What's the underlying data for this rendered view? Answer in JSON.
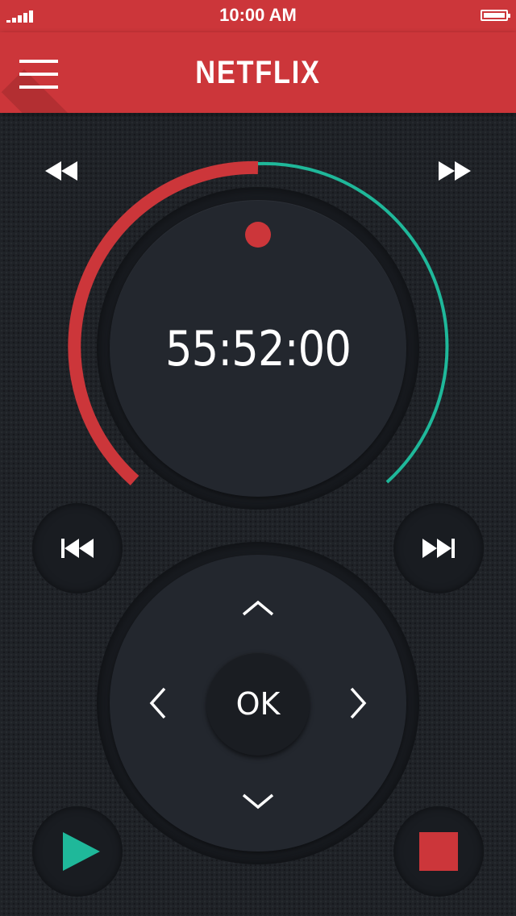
{
  "status_bar": {
    "time": "10:00 AM"
  },
  "header": {
    "brand": "NETFLIX"
  },
  "timer": {
    "value": "55:52:00",
    "progress": 0.5
  },
  "controls": {
    "ok_label": "OK"
  },
  "colors": {
    "accent_red": "#cc363a",
    "accent_teal": "#1fb89a",
    "background": "#1f2227",
    "button_face": "#23272e"
  },
  "icons": {
    "menu": "menu-icon",
    "rewind": "rewind-icon",
    "fast_forward": "fast-forward-icon",
    "skip_previous": "skip-previous-icon",
    "skip_next": "skip-next-icon",
    "up": "chevron-up-icon",
    "down": "chevron-down-icon",
    "left": "chevron-left-icon",
    "right": "chevron-right-icon",
    "play": "play-icon",
    "stop": "stop-icon",
    "record": "record-dot-icon"
  }
}
